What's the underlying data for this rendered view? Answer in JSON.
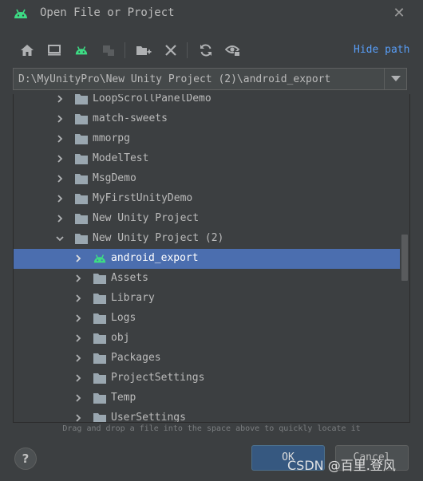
{
  "window": {
    "title": "Open File or Project",
    "android_color": "#3ddc84",
    "icon": "android-icon",
    "close_icon": "close-icon"
  },
  "toolbar": {
    "buttons": [
      "home-icon",
      "desktop-icon",
      "android-project-icon",
      "module-icon",
      "new-folder-icon",
      "delete-icon",
      "refresh-icon",
      "show-hidden-icon"
    ],
    "hide_path_label": "Hide path",
    "link_color": "#589df6"
  },
  "path": {
    "value": "D:\\MyUnityPro\\New Unity Project (2)\\android_export"
  },
  "tree": {
    "selection_color": "#4b6eaf",
    "rows": [
      {
        "label": "LoopScrollPanelDemo",
        "level": 1,
        "expanded": false,
        "icon": "folder-icon"
      },
      {
        "label": "match-sweets",
        "level": 1,
        "expanded": false,
        "icon": "folder-icon"
      },
      {
        "label": "mmorpg",
        "level": 1,
        "expanded": false,
        "icon": "folder-icon"
      },
      {
        "label": "ModelTest",
        "level": 1,
        "expanded": false,
        "icon": "folder-icon"
      },
      {
        "label": "MsgDemo",
        "level": 1,
        "expanded": false,
        "icon": "folder-icon"
      },
      {
        "label": "MyFirstUnityDemo",
        "level": 1,
        "expanded": false,
        "icon": "folder-icon"
      },
      {
        "label": "New Unity Project",
        "level": 1,
        "expanded": false,
        "icon": "folder-icon"
      },
      {
        "label": "New Unity Project (2)",
        "level": 1,
        "expanded": true,
        "icon": "folder-icon"
      },
      {
        "label": "android_export",
        "level": 2,
        "expanded": false,
        "icon": "android-icon",
        "selected": true
      },
      {
        "label": "Assets",
        "level": 2,
        "expanded": false,
        "icon": "folder-icon"
      },
      {
        "label": "Library",
        "level": 2,
        "expanded": false,
        "icon": "folder-icon"
      },
      {
        "label": "Logs",
        "level": 2,
        "expanded": false,
        "icon": "folder-icon"
      },
      {
        "label": "obj",
        "level": 2,
        "expanded": false,
        "icon": "folder-icon"
      },
      {
        "label": "Packages",
        "level": 2,
        "expanded": false,
        "icon": "folder-icon"
      },
      {
        "label": "ProjectSettings",
        "level": 2,
        "expanded": false,
        "icon": "folder-icon"
      },
      {
        "label": "Temp",
        "level": 2,
        "expanded": false,
        "icon": "folder-icon"
      },
      {
        "label": "UserSettings",
        "level": 2,
        "expanded": false,
        "icon": "folder-icon"
      }
    ]
  },
  "hint": "Drag and drop a file into the space above to quickly locate it",
  "footer": {
    "help_label": "?",
    "ok_label": "OK",
    "cancel_label": "Cancel"
  },
  "watermark": "CSDN @百里.登风"
}
